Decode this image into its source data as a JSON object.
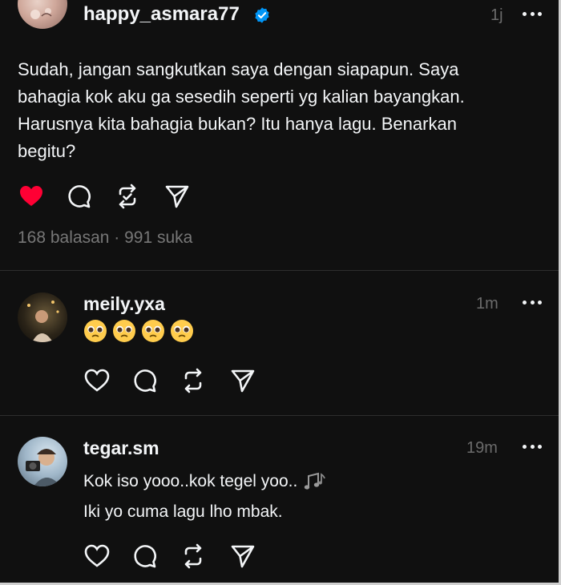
{
  "post": {
    "username": "happy_asmara77",
    "time": "1j",
    "text_lines": [
      "Sudah, jangan sangkutkan saya dengan siapapun. Saya",
      "bahagia kok aku ga sesedih seperti yg kalian bayangkan.",
      "Harusnya kita bahagia bukan? Itu hanya lagu. Benarkan",
      "begitu?"
    ],
    "replies": "168 balasan",
    "separator": "·",
    "likes": "991 suka",
    "liked": true,
    "like_color": "#ff0034"
  },
  "replies": [
    {
      "username": "meily.yxa",
      "time": "1m",
      "emoji_count": 4,
      "emoji_name": "pleading-face"
    },
    {
      "username": "tegar.sm",
      "time": "19m",
      "line1": "Kok iso yooo..kok tegel yoo..",
      "line2": "Iki yo cuma lagu lho mbak.",
      "trailing_icon": "music-notes-icon"
    }
  ],
  "colors": {
    "background": "#101010",
    "text": "#f3f5f7",
    "muted": "#777777",
    "verified": "#0095f6"
  }
}
